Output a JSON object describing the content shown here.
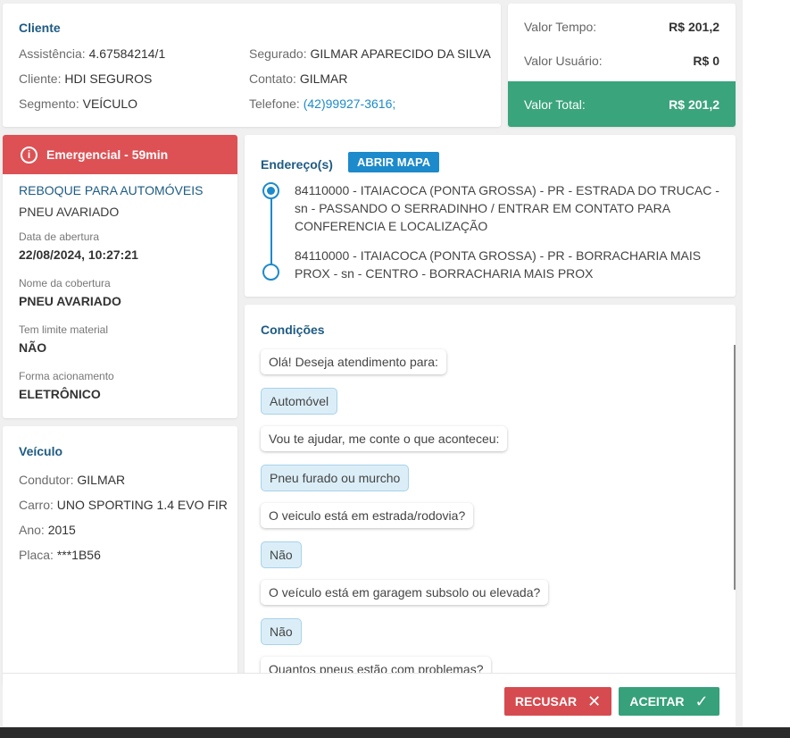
{
  "cliente": {
    "title": "Cliente",
    "assistencia_label": "Assistência:",
    "assistencia": "4.67584214/1",
    "cliente_label": "Cliente:",
    "cliente": "HDI SEGUROS",
    "segmento_label": "Segmento:",
    "segmento": "VEÍCULO",
    "segurado_label": "Segurado:",
    "segurado": "GILMAR APARECIDO DA SILVA",
    "contato_label": "Contato:",
    "contato": "GILMAR",
    "telefone_label": "Telefone:",
    "telefone": "(42)99927-3616;"
  },
  "valores": {
    "tempo_label": "Valor Tempo:",
    "tempo": "R$ 201,2",
    "usuario_label": "Valor Usuário:",
    "usuario": "R$ 0",
    "total_label": "Valor Total:",
    "total": "R$ 201,2",
    "total_color": "#3aa47c"
  },
  "servico": {
    "banner": "Emergencial - 59min",
    "banner_icon": "info-icon",
    "banner_color": "#dd5154",
    "tipo": "REBOQUE PARA AUTOMÓVEIS",
    "motivo": "PNEU AVARIADO",
    "abertura_label": "Data de abertura",
    "abertura": "22/08/2024, 10:27:21",
    "cobertura_label": "Nome da cobertura",
    "cobertura": "PNEU AVARIADO",
    "limite_label": "Tem limite material",
    "limite": "NÃO",
    "forma_label": "Forma acionamento",
    "forma": "ELETRÔNICO"
  },
  "veiculo": {
    "title": "Veículo",
    "condutor_label": "Condutor:",
    "condutor": "GILMAR",
    "carro_label": "Carro:",
    "carro": "UNO SPORTING 1.4 EVO FIR",
    "ano_label": "Ano:",
    "ano": "2015",
    "placa_label": "Placa:",
    "placa": "***1B56"
  },
  "endereco": {
    "title": "Endereço(s)",
    "map_button": "ABRIR MAPA",
    "origem": "84110000 - ITAIACOCA (PONTA GROSSA) - PR - ESTRADA DO TRUCAC - sn - PASSANDO O SERRADINHO / ENTRAR EM CONTATO PARA CONFERENCIA E LOCALIZAÇÃO",
    "destino": "84110000 - ITAIACOCA (PONTA GROSSA) - PR - BORRACHARIA MAIS PROX - sn - CENTRO - BORRACHARIA MAIS PROX"
  },
  "condicoes": {
    "title": "Condições",
    "messages": [
      "Olá! Deseja atendimento para:",
      "Automóvel",
      "Vou te ajudar, me conte o que aconteceu:",
      "Pneu furado ou murcho",
      "O veiculo está em estrada/rodovia?",
      "Não",
      "O veículo está em garagem subsolo ou elevada?",
      "Não",
      "Quantos pneus estão com problemas?"
    ]
  },
  "footer": {
    "recusar": "RECUSAR",
    "aceitar": "ACEITAR"
  }
}
